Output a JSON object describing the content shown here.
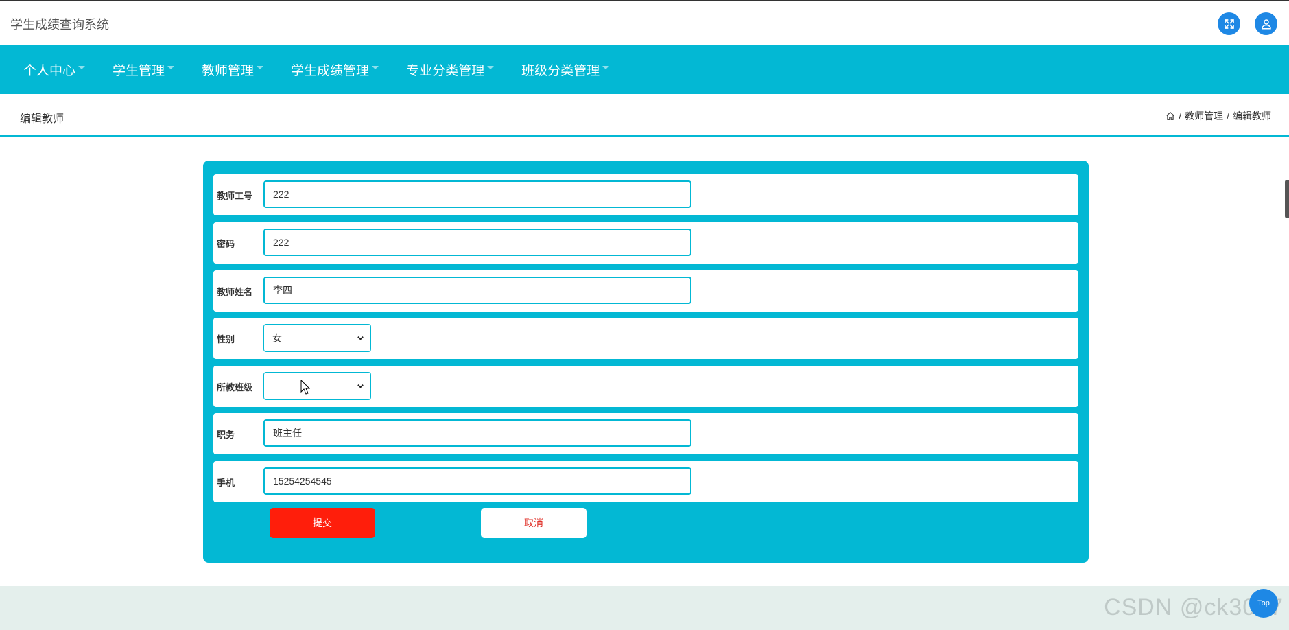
{
  "app": {
    "title": "学生成绩查询系统",
    "accent": "#03b8d4",
    "icons": [
      "fullscreen-icon",
      "user-icon"
    ]
  },
  "nav": {
    "items": [
      {
        "label": "个人中心"
      },
      {
        "label": "学生管理"
      },
      {
        "label": "教师管理"
      },
      {
        "label": "学生成绩管理"
      },
      {
        "label": "专业分类管理"
      },
      {
        "label": "班级分类管理"
      }
    ]
  },
  "page": {
    "title": "编辑教师",
    "breadcrumb": {
      "sep": "/",
      "section": "教师管理",
      "current": "编辑教师"
    }
  },
  "form": {
    "fields": {
      "teacher_id": {
        "label": "教师工号",
        "value": "222"
      },
      "password": {
        "label": "密码",
        "value": "222"
      },
      "name": {
        "label": "教师姓名",
        "value": "李四"
      },
      "gender": {
        "label": "性别",
        "value": "女"
      },
      "class": {
        "label": "所教班级",
        "value": ""
      },
      "position": {
        "label": "职务",
        "value": "班主任"
      },
      "phone": {
        "label": "手机",
        "value": "15254254545"
      }
    },
    "submit_label": "提交",
    "cancel_label": "取消",
    "submit_color": "#ff1e0b"
  },
  "misc": {
    "top_button_label": "Top",
    "watermark": "CSDN @ck3017"
  }
}
